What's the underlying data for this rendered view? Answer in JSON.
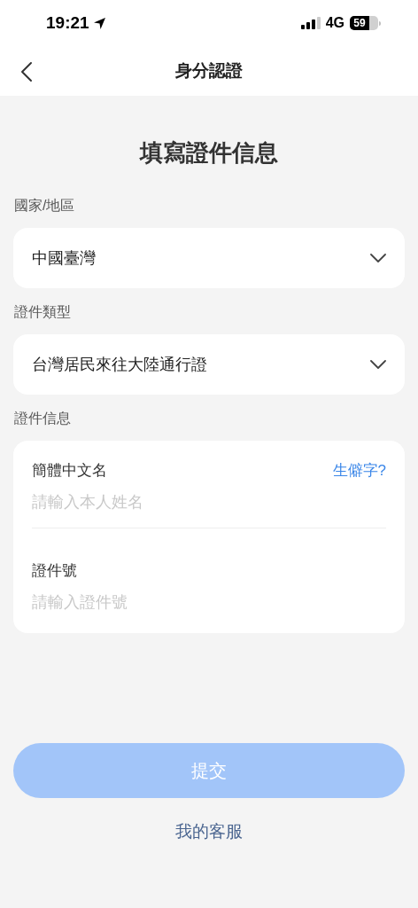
{
  "status_bar": {
    "time": "19:21",
    "network": "4G",
    "battery": "59"
  },
  "nav": {
    "title": "身分認證"
  },
  "heading": "填寫證件信息",
  "selects": [
    {
      "label": "國家/地區",
      "value": "中國臺灣"
    },
    {
      "label": "證件類型",
      "value": "台灣居民來往大陸通行證"
    }
  ],
  "info": {
    "label": "證件信息",
    "fields": [
      {
        "label": "簡體中文名",
        "placeholder": "請輸入本人姓名",
        "link": "生僻字?"
      },
      {
        "label": "證件號",
        "placeholder": "請輸入證件號"
      }
    ]
  },
  "submit": {
    "label": "提交",
    "disabled": true
  },
  "service_link": "我的客服"
}
